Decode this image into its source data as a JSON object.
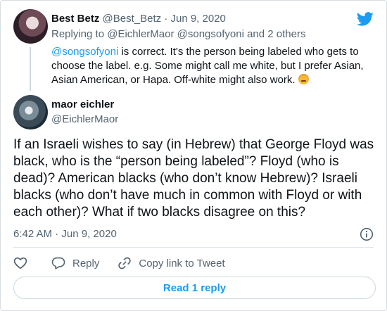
{
  "parent_tweet": {
    "author_name": "Best Betz",
    "author_handle": "@Best_Betz",
    "separator": "·",
    "date": "Jun 9, 2020",
    "replying_to_prefix": "Replying to",
    "replying_to_users": "@EichlerMaor @songsofyoni",
    "replying_to_suffix": "and 2 others",
    "mention": "@songsofyoni",
    "body_text": " is correct.  It's the person being labeled who gets to choose the label.  e.g. Some might call me white, but I prefer Asian, Asian American, or Hapa.  Off-white might also work. ",
    "emoji": "winking-face"
  },
  "reply_tweet": {
    "author_name": "maor eichler",
    "author_handle": "@EichlerMaor",
    "body_text": "If an Israeli wishes to say (in Hebrew) that George Floyd was black, who is the “person being labeled”? Floyd (who is dead)? American blacks (who don’t know Hebrew)? Israeli blacks (who don’t have much in common with Floyd or with each other)? What if two blacks disagree on this?",
    "time": "6:42 AM",
    "separator": "·",
    "date": "Jun 9, 2020"
  },
  "actions": {
    "reply_label": "Reply",
    "copy_link_label": "Copy link to Tweet"
  },
  "read_replies_label": "Read 1 reply",
  "colors": {
    "accent": "#1d9bf0",
    "muted_text": "#536471",
    "text": "#0f1419",
    "border": "#cfd9de"
  },
  "icons": [
    "twitter-bird-icon",
    "info-icon",
    "heart-icon",
    "reply-bubble-icon",
    "link-icon"
  ]
}
